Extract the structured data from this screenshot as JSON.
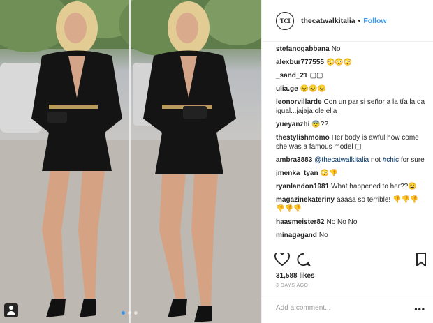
{
  "post": {
    "username": "thecatwalkitalia",
    "separator": "•",
    "follow_label": "Follow",
    "avatar_text": "TCI",
    "carousel_dot_count": 3,
    "carousel_active_index": 0
  },
  "comments": [
    {
      "user": "stefanogabbana",
      "text": "No"
    },
    {
      "user": "alexbur777555",
      "text": "😳😳😳"
    },
    {
      "user": "_sand_21",
      "text": "▢▢"
    },
    {
      "user": "ulia.ge",
      "text": "😣😣😣"
    },
    {
      "user": "leonorvillarde",
      "text": "Con un par si señor a la tía la da igual...jajaja,ole ella"
    },
    {
      "user": "yueyanzhi",
      "text": "😨??"
    },
    {
      "user": "thestylishmomo",
      "text": "Her body is awful how come she was a famous model ▢"
    },
    {
      "user": "ambra3883",
      "mention": "@thecatwalkitalia",
      "text": "not",
      "hashtag": "#chic",
      "text2": "for sure"
    },
    {
      "user": "jmenka_tyan",
      "text": "😳👎"
    },
    {
      "user": "ryanlandon1981",
      "text": "What happened to her??😩"
    },
    {
      "user": "magazinekateriny",
      "text": "aaaaa so terrible! 👎👎👎👎👎👎"
    },
    {
      "user": "haasmeister82",
      "text": "No No No"
    },
    {
      "user": "minagagand",
      "text": "No"
    }
  ],
  "footer": {
    "likes": "31,588 likes",
    "time": "3 DAYS AGO",
    "add_comment_placeholder": "Add a comment...",
    "more_label": "•••"
  },
  "icons": [
    "heart-icon",
    "comment-icon",
    "bookmark-icon",
    "user-tag-icon"
  ],
  "colors": {
    "link": "#3897f0",
    "mention": "#003569",
    "text": "#262626",
    "muted": "#999999"
  }
}
